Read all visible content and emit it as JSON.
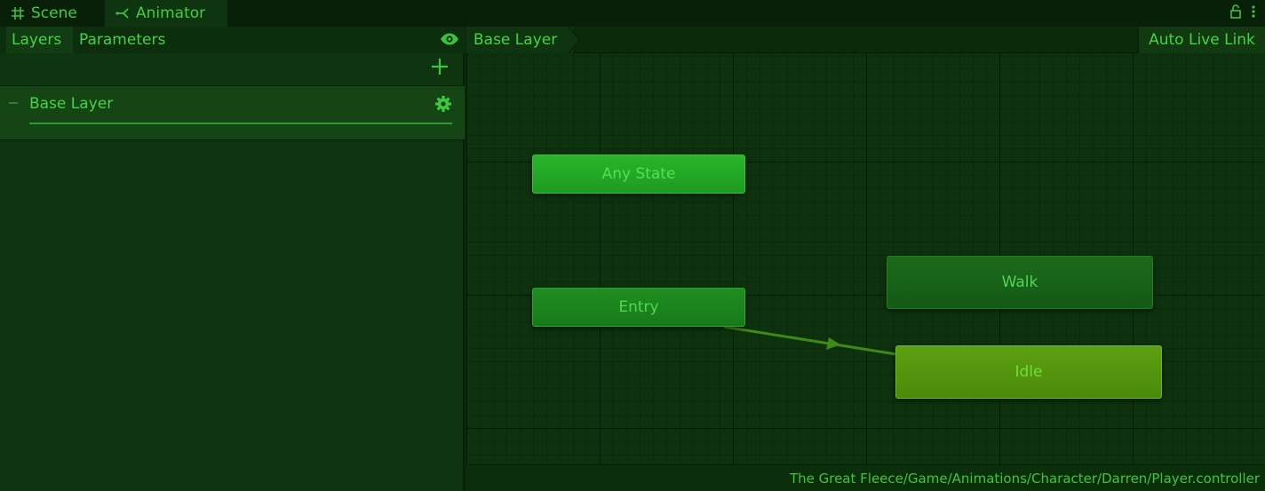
{
  "tabs": [
    {
      "label": "Scene",
      "icon": "grid-hash-icon"
    },
    {
      "label": "Animator",
      "icon": "animator-icon"
    }
  ],
  "left_panel": {
    "tabs": {
      "layers": "Layers",
      "parameters": "Parameters"
    },
    "layers": [
      {
        "name": "Base Layer"
      }
    ]
  },
  "graph": {
    "breadcrumb": "Base Layer",
    "live_link_label": "Auto Live Link",
    "states": {
      "any_state": "Any State",
      "entry": "Entry",
      "walk": "Walk",
      "idle": "Idle"
    },
    "asset_path": "The Great Fleece/Game/Animations/Character/Darren/Player.controller"
  },
  "colors": {
    "accent": "#3fcf3f",
    "idle_state": "#5ea013",
    "any_state": "#29b52b",
    "background": "#0b2a0b"
  }
}
